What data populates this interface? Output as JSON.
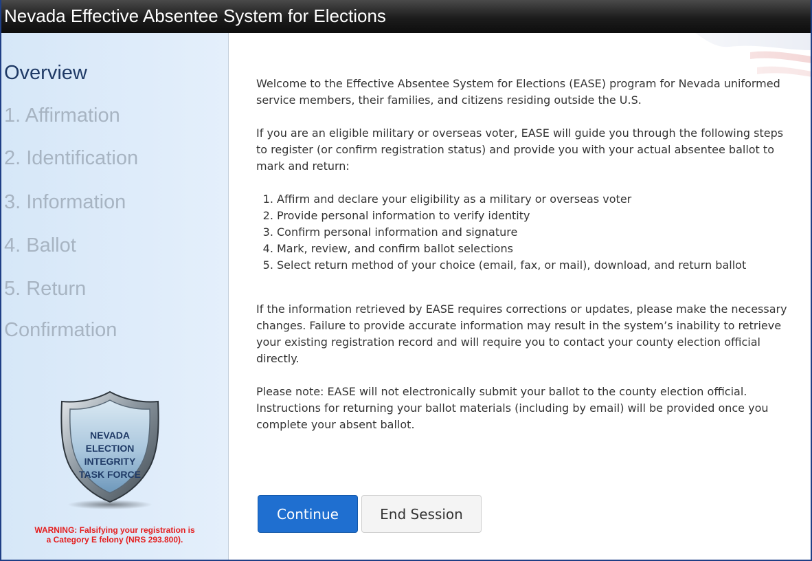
{
  "app": {
    "title": "Nevada Effective Absentee System for Elections"
  },
  "sidebar": {
    "items": [
      {
        "label": "Overview",
        "active": true
      },
      {
        "label": "1. Affirmation",
        "active": false
      },
      {
        "label": "2. Identification",
        "active": false
      },
      {
        "label": "3. Information",
        "active": false
      },
      {
        "label": "4. Ballot",
        "active": false
      },
      {
        "label": "5. Return",
        "active": false
      },
      {
        "label": "Confirmation",
        "active": false
      }
    ],
    "badge": {
      "line1": "NEVADA",
      "line2": "ELECTION",
      "line3": "INTEGRITY",
      "line4": "TASK FORCE"
    },
    "warning": {
      "line1": "WARNING: Falsifying your registration is",
      "line2": "a Category E felony (NRS 293.800)."
    }
  },
  "main": {
    "intro": "Welcome to the Effective Absentee System for Elections (EASE) program for Nevada uniformed service members, their families, and citizens residing outside the U.S.",
    "guide": "If you are an eligible military or overseas voter, EASE will guide you through the following steps to register (or confirm registration status) and provide you with your actual absentee ballot to mark and return:",
    "steps": [
      "Affirm and declare your eligibility as a military or overseas voter",
      "Provide personal information to verify identity",
      "Confirm personal information and signature",
      "Mark, review, and confirm ballot selections",
      "Select return method of your choice (email, fax, or mail), download, and return ballot"
    ],
    "corrections": "If the information retrieved by EASE requires corrections or updates, please make the necessary changes. Failure to provide accurate information may result in the system’s inability to retrieve your existing registration record and will require you to contact your county election official directly.",
    "note": "Please note:  EASE will not electronically submit your ballot to the county election official. Instructions for returning your ballot materials (including by email) will be provided once you complete your absent ballot."
  },
  "buttons": {
    "continue": "Continue",
    "end_session": "End Session"
  },
  "colors": {
    "title_bar": "#1c1c1c",
    "sidebar_bg": "#dceaf9",
    "nav_active": "#1f3a66",
    "nav_inactive": "#a7b4c2",
    "primary_button": "#1f6fd0",
    "warning_text": "#e41e1e"
  }
}
